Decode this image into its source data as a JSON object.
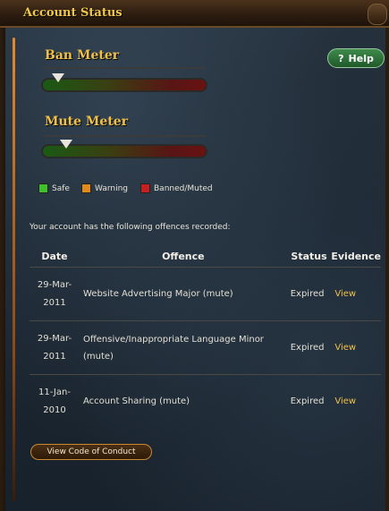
{
  "window": {
    "title": "Account Status"
  },
  "help_button": {
    "label": "Help",
    "icon": "question-icon"
  },
  "meters": [
    {
      "label": "Ban Meter",
      "level": 0.02
    },
    {
      "label": "Mute Meter",
      "level": 0.08
    }
  ],
  "legend": [
    {
      "label": "Safe",
      "color": "#3fbf2b"
    },
    {
      "label": "Warning",
      "color": "#e08a1e"
    },
    {
      "label": "Banned/Muted",
      "color": "#c42020"
    }
  ],
  "intro_text": "Your account has the following offences recorded:",
  "table": {
    "headers": [
      "Date",
      "Offence",
      "Status",
      "Evidence"
    ],
    "rows": [
      {
        "date_a": "29-Mar-",
        "date_b": "2011",
        "offence": "Website Advertising Major (mute)",
        "status": "Expired",
        "evidence": "View"
      },
      {
        "date_a": "29-Mar-",
        "date_b": "2011",
        "offence": "Offensive/Inappropriate Language Minor (mute)",
        "status": "Expired",
        "evidence": "View"
      },
      {
        "date_a": "11-Jan-",
        "date_b": "2010",
        "offence": "Account Sharing (mute)",
        "status": "Expired",
        "evidence": "View"
      }
    ]
  },
  "code_button": {
    "label": "View Code of Conduct"
  }
}
